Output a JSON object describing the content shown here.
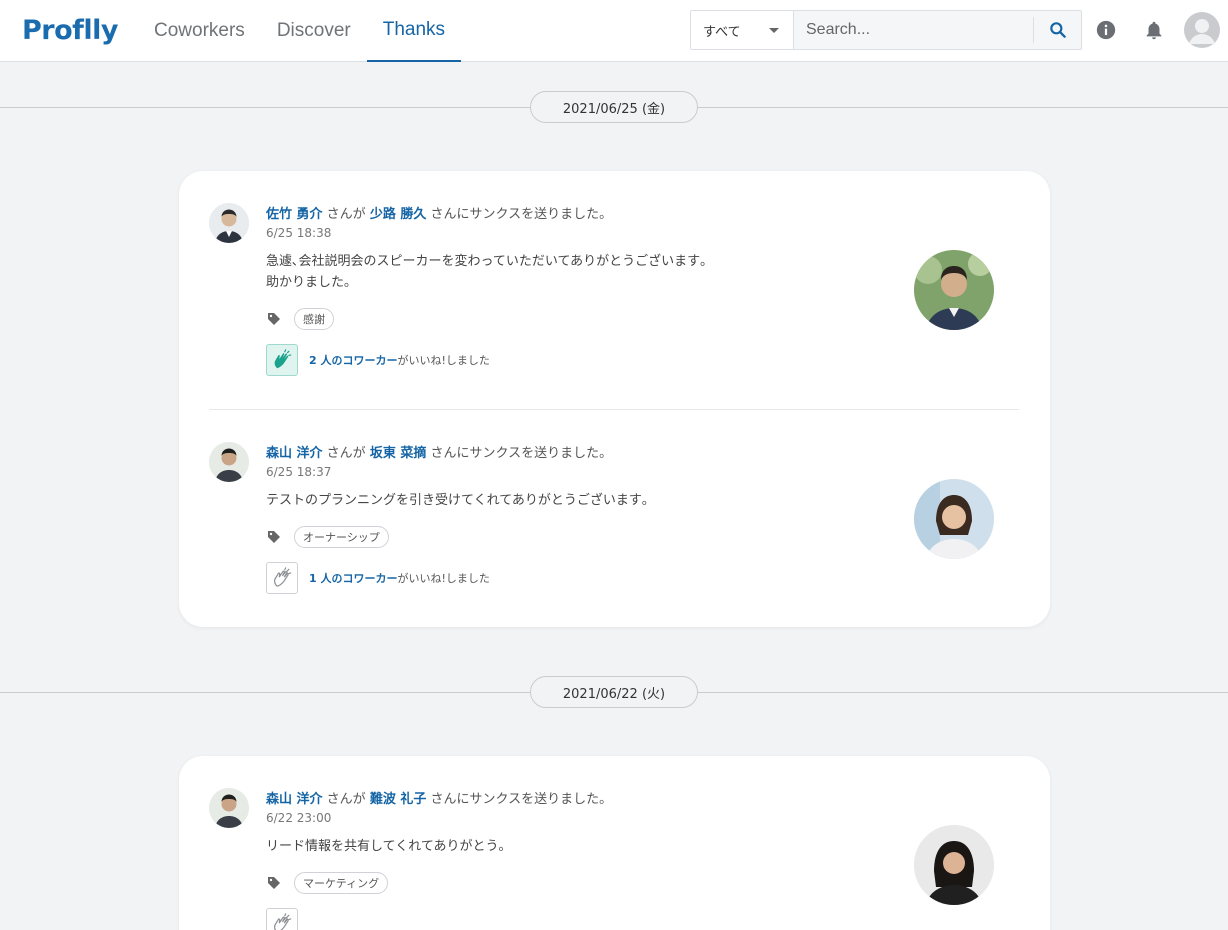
{
  "brand": {
    "logo_text": "Proflly",
    "accent": "#1565a6"
  },
  "nav": {
    "items": [
      {
        "label": "Coworkers"
      },
      {
        "label": "Discover"
      },
      {
        "label": "Thanks",
        "active": true
      }
    ]
  },
  "search": {
    "scope_selected": "すべて",
    "placeholder": "Search..."
  },
  "header_icons": [
    "info-icon",
    "bell-icon",
    "user-avatar-icon"
  ],
  "groups": [
    {
      "date": "2021/06/25 (金)",
      "entries": [
        {
          "sender": "佐竹 勇介",
          "connector": "さんが",
          "recipient": "少路 勝久",
          "action": "さんにサンクスを送りました。",
          "time": "6/25 18:38",
          "message_lines": [
            "急遽､会社説明会のスピーカーを変わっていただいてありがとうございます｡",
            "助かりました｡"
          ],
          "tag": "感謝",
          "like_count": "2 人のコワーカー",
          "like_suffix": "がいいね!しました",
          "liked": true
        },
        {
          "sender": "森山 洋介",
          "connector": "さんが",
          "recipient": "坂東 菜摘",
          "action": "さんにサンクスを送りました。",
          "time": "6/25 18:37",
          "message_lines": [
            "テストのプランニングを引き受けてくれてありがとうございます｡"
          ],
          "tag": "オーナーシップ",
          "like_count": "1 人のコワーカー",
          "like_suffix": "がいいね!しました",
          "liked": false
        }
      ]
    },
    {
      "date": "2021/06/22 (火)",
      "entries": [
        {
          "sender": "森山 洋介",
          "connector": "さんが",
          "recipient": "難波 礼子",
          "action": "さんにサンクスを送りました。",
          "time": "6/22 23:00",
          "message_lines": [
            "リード情報を共有してくれてありがとう｡"
          ],
          "tag": "マーケティング",
          "liked": false
        }
      ]
    }
  ]
}
